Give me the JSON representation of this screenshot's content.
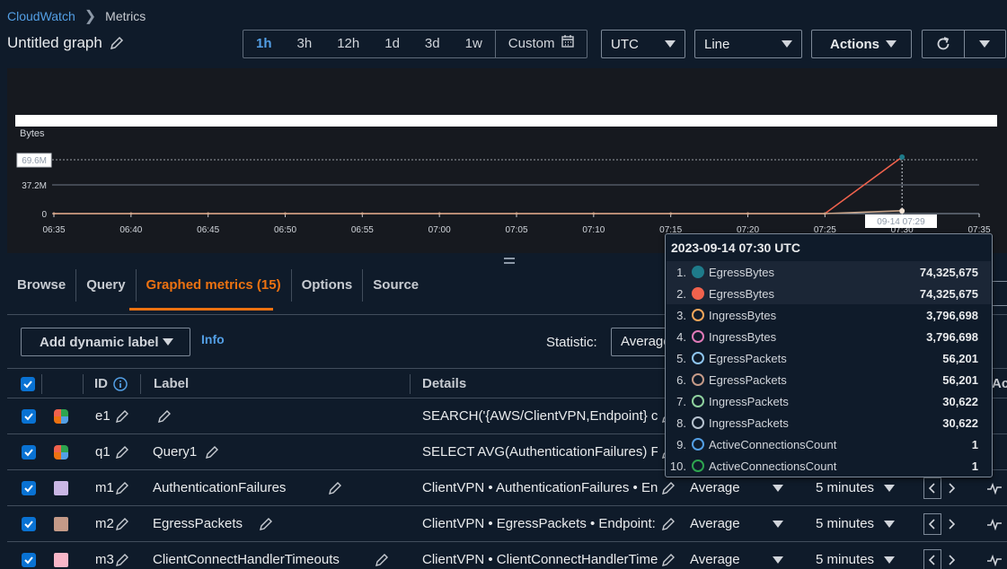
{
  "breadcrumb": {
    "root": "CloudWatch",
    "current": "Metrics"
  },
  "graph": {
    "title": "Untitled graph"
  },
  "time_range": {
    "options": [
      "1h",
      "3h",
      "12h",
      "1d",
      "3d",
      "1w"
    ],
    "active": "1h",
    "custom_label": "Custom",
    "timezone": "UTC"
  },
  "chart_type": "Line",
  "actions_label": "Actions",
  "chart_data": {
    "type": "line",
    "ylabel": "Bytes",
    "y_ticks": [
      "69.6M",
      "37.2M",
      "0"
    ],
    "ylim": [
      0,
      74325675
    ],
    "x_ticks": [
      "06:35",
      "06:40",
      "06:45",
      "06:50",
      "06:55",
      "07:00",
      "07:05",
      "07:10",
      "07:15",
      "07:20",
      "07:25",
      "07:30",
      "07:35"
    ],
    "hover_label": "09-14 07:29",
    "series": [
      {
        "name": "EgressBytes",
        "color": "#f0624d",
        "x": [
          "06:35",
          "06:40",
          "06:45",
          "06:50",
          "06:55",
          "07:00",
          "07:05",
          "07:10",
          "07:15",
          "07:20",
          "07:25",
          "07:30"
        ],
        "values": [
          0,
          0,
          0,
          0,
          0,
          0,
          0,
          0,
          0,
          0,
          0,
          74325675
        ]
      },
      {
        "name": "IngressBytes",
        "color": "#c9a58a",
        "x": [
          "06:35",
          "06:40",
          "06:45",
          "06:50",
          "06:55",
          "07:00",
          "07:05",
          "07:10",
          "07:15",
          "07:20",
          "07:25",
          "07:30"
        ],
        "values": [
          0,
          0,
          0,
          0,
          0,
          0,
          0,
          0,
          0,
          0,
          0,
          3796698
        ]
      }
    ]
  },
  "tabs": [
    "Browse",
    "Query",
    "Graphed metrics (15)",
    "Options",
    "Source"
  ],
  "active_tab": "Graphed metrics (15)",
  "controls": {
    "add_dynamic_label": "Add dynamic label",
    "info": "Info",
    "statistic_label": "Statistic:",
    "statistic_value": "Average"
  },
  "table": {
    "headers": {
      "id": "ID",
      "label": "Label",
      "details": "Details",
      "actions": "Act"
    },
    "rows": [
      {
        "id": "e1",
        "label": "",
        "details": "SEARCH('{AWS/ClientVPN,Endpoint} c...",
        "statistic": "",
        "period": ""
      },
      {
        "id": "q1",
        "label": "Query1",
        "details": "SELECT AVG(AuthenticationFailures) F...",
        "statistic": "",
        "period": ""
      },
      {
        "id": "m1",
        "label": "AuthenticationFailures",
        "details": "ClientVPN • AuthenticationFailures • Endp",
        "statistic": "Average",
        "period": "5 minutes",
        "color": "#c9b6e4"
      },
      {
        "id": "m2",
        "label": "EgressPackets",
        "details": "ClientVPN • EgressPackets • Endpoint: cvp",
        "statistic": "Average",
        "period": "5 minutes",
        "color": "#c49a88"
      },
      {
        "id": "m3",
        "label": "ClientConnectHandlerTimeouts",
        "details": "ClientVPN • ClientConnectHandlerTimeou",
        "statistic": "Average",
        "period": "5 minutes",
        "color": "#f7b6c8"
      }
    ]
  },
  "tooltip": {
    "title": "2023-09-14 07:30 UTC",
    "items": [
      {
        "idx": "1.",
        "name": "EgressBytes",
        "value": "74,325,675",
        "color": "#1e7b8a",
        "filled": true,
        "highlight": true
      },
      {
        "idx": "2.",
        "name": "EgressBytes",
        "value": "74,325,675",
        "color": "#f0624d",
        "filled": true,
        "highlight": true
      },
      {
        "idx": "3.",
        "name": "IngressBytes",
        "value": "3,796,698",
        "color": "#f2a65a",
        "filled": false
      },
      {
        "idx": "4.",
        "name": "IngressBytes",
        "value": "3,796,698",
        "color": "#e07ab8",
        "filled": false
      },
      {
        "idx": "5.",
        "name": "EgressPackets",
        "value": "56,201",
        "color": "#8ec5ee",
        "filled": false
      },
      {
        "idx": "6.",
        "name": "EgressPackets",
        "value": "56,201",
        "color": "#c49a88",
        "filled": false
      },
      {
        "idx": "7.",
        "name": "IngressPackets",
        "value": "30,622",
        "color": "#8fd19e",
        "filled": false
      },
      {
        "idx": "8.",
        "name": "IngressPackets",
        "value": "30,622",
        "color": "#b7c3d0",
        "filled": false
      },
      {
        "idx": "9.",
        "name": "ActiveConnectionsCount",
        "value": "1",
        "color": "#539fe5",
        "filled": false
      },
      {
        "idx": "10.",
        "name": "ActiveConnectionsCount",
        "value": "1",
        "color": "#2ea44f",
        "filled": false
      }
    ]
  }
}
